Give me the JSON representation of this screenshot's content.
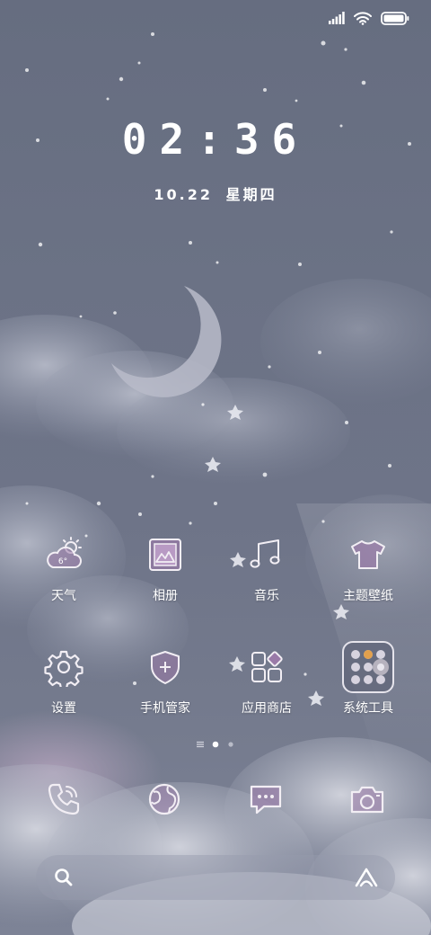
{
  "status": {
    "signal_icon": "signal-icon",
    "wifi_icon": "wifi-icon",
    "battery_icon": "battery-icon"
  },
  "lockscreen": {
    "time": "02:36",
    "date": "10.22",
    "weekday": "星期四"
  },
  "apps": [
    {
      "label": "天气",
      "icon": "weather-icon",
      "temp": "6°"
    },
    {
      "label": "相册",
      "icon": "gallery-icon"
    },
    {
      "label": "音乐",
      "icon": "music-icon"
    },
    {
      "label": "主题壁纸",
      "icon": "theme-icon"
    },
    {
      "label": "设置",
      "icon": "settings-icon"
    },
    {
      "label": "手机管家",
      "icon": "security-icon"
    },
    {
      "label": "应用商店",
      "icon": "app-store-icon"
    },
    {
      "label": "系统工具",
      "icon": "system-tools-folder-icon"
    }
  ],
  "page_indicator": {
    "pages": 2,
    "current": 1
  },
  "dock": [
    {
      "name": "phone",
      "icon": "phone-icon"
    },
    {
      "name": "browser",
      "icon": "browser-icon"
    },
    {
      "name": "messages",
      "icon": "message-icon"
    },
    {
      "name": "camera",
      "icon": "camera-icon"
    }
  ],
  "search": {
    "placeholder": "",
    "search_icon": "search-icon",
    "assistant_icon": "assistant-icon"
  },
  "colors": {
    "accent_purple": "#9a7aa8",
    "text": "#ffffff",
    "icon_tint": "#f2eef4"
  }
}
